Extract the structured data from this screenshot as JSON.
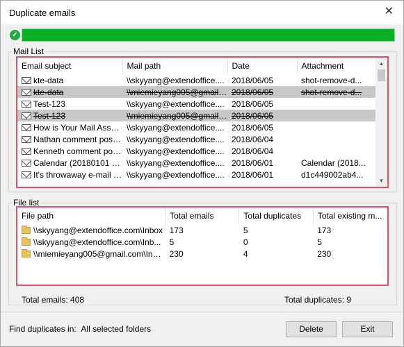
{
  "window": {
    "title": "Duplicate emails"
  },
  "progress": {
    "value": 1.0,
    "color": "#06b025"
  },
  "mail_list": {
    "legend": "Mail List",
    "columns": [
      "Email subject",
      "Mail path",
      "Date",
      "Attachment"
    ],
    "rows": [
      {
        "subject": "kte-data",
        "path": "\\\\skyyang@extendoffice....",
        "date": "2018/06/05",
        "attachment": "shot-remove-d...",
        "dup": false
      },
      {
        "subject": "kte-data",
        "path": "\\\\miemieyang005@gmail....",
        "date": "2018/06/05",
        "attachment": "shot-remove-d...",
        "dup": true
      },
      {
        "subject": "Test-123",
        "path": "\\\\skyyang@extendoffice....",
        "date": "2018/06/05",
        "attachment": "",
        "dup": false
      },
      {
        "subject": "Test-123",
        "path": "\\\\miemieyang005@gmail....",
        "date": "2018/06/05",
        "attachment": "",
        "dup": true
      },
      {
        "subject": "How is Your Mail Assur...",
        "path": "\\\\skyyang@extendoffice....",
        "date": "2018/06/05",
        "attachment": "",
        "dup": false
      },
      {
        "subject": "Nathan comment posti...",
        "path": "\\\\skyyang@extendoffice....",
        "date": "2018/06/04",
        "attachment": "",
        "dup": false
      },
      {
        "subject": "Kenneth comment posti...",
        "path": "\\\\skyyang@extendoffice....",
        "date": "2018/06/04",
        "attachment": "",
        "dup": false
      },
      {
        "subject": "Calendar (20180101 - ...",
        "path": "\\\\skyyang@extendoffice....",
        "date": "2018/06/01",
        "attachment": "Calendar (2018...",
        "dup": false
      },
      {
        "subject": "It's throwaway e-mail ti...",
        "path": "\\\\skyyang@extendoffice....",
        "date": "2018/06/01",
        "attachment": "d1c449002ab4...",
        "dup": false
      }
    ]
  },
  "file_list": {
    "legend": "File list",
    "columns": [
      "File path",
      "Total emails",
      "Total duplicates",
      "Total existing m..."
    ],
    "rows": [
      {
        "path": "\\\\skyyang@extendoffice.com\\Inbox",
        "emails": "173",
        "dups": "5",
        "existing": "173"
      },
      {
        "path": "\\\\skyyang@extendoffice.com\\Inb...",
        "emails": "5",
        "dups": "0",
        "existing": "5"
      },
      {
        "path": "\\\\miemieyang005@gmail.com\\Inbox",
        "emails": "230",
        "dups": "4",
        "existing": "230"
      }
    ]
  },
  "totals": {
    "emails": "Total emails: 408",
    "duplicates": "Total duplicates: 9"
  },
  "footer": {
    "find_label": "Find duplicates in:",
    "find_value": "All selected folders",
    "delete_label": "Delete",
    "exit_label": "Exit"
  }
}
